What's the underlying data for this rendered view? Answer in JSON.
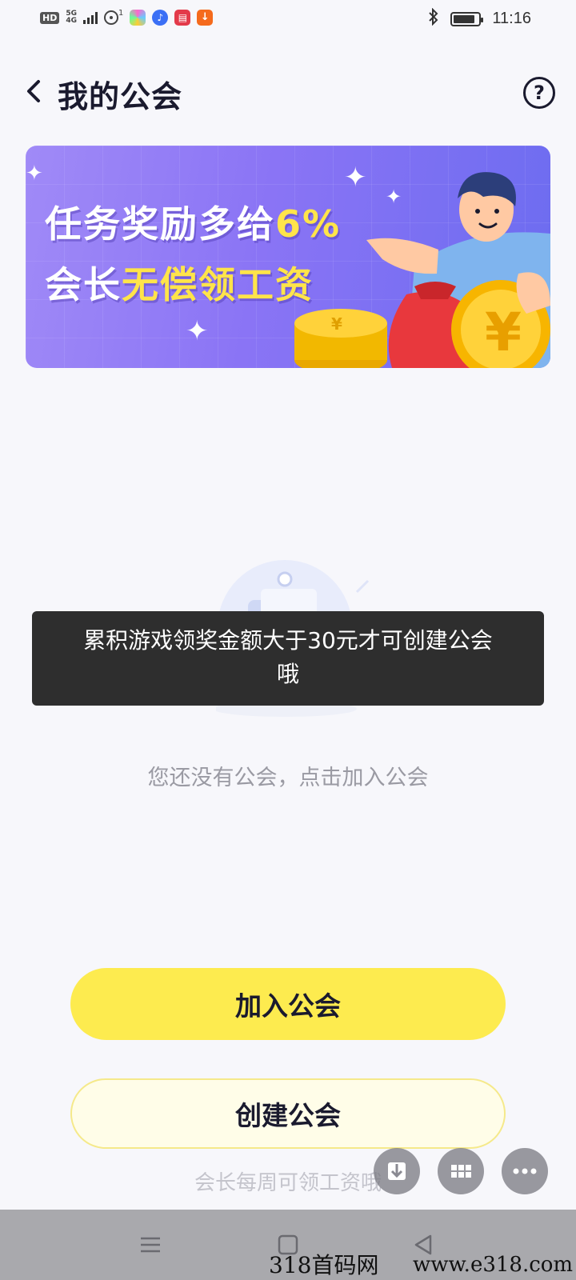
{
  "status_bar": {
    "hd": "HD",
    "network_top": "5G",
    "network_bottom": "4G",
    "hotspot_count": "1",
    "time": "11:16",
    "battery_level": 0.85
  },
  "header": {
    "title": "我的公会",
    "back_icon": "chevron-left-icon",
    "help_icon": "question-circle-icon",
    "help_symbol": "?"
  },
  "banner": {
    "line1_prefix": "任务奖励多给",
    "line1_highlight": "6%",
    "line2_prefix": "会长",
    "line2_highlight": "无偿领工资",
    "accent": "#ffe44a"
  },
  "toast": {
    "line1": "累积游戏领奖金额大于30元才可创建公会",
    "line2": "哦"
  },
  "empty_state": {
    "text": "您还没有公会，点击加入公会"
  },
  "actions": {
    "join_label": "加入公会",
    "create_label": "创建公会",
    "footnote": "会长每周可领工资哦"
  },
  "floating_buttons": [
    "download-icon",
    "grid-icon",
    "more-icon"
  ],
  "watermark": {
    "left": "318首码网",
    "right": "www.e318.com"
  },
  "colors": {
    "primary_yellow": "#fdeb4f",
    "light_yellow": "#fffde8",
    "banner_purple": "#8a74f5"
  }
}
